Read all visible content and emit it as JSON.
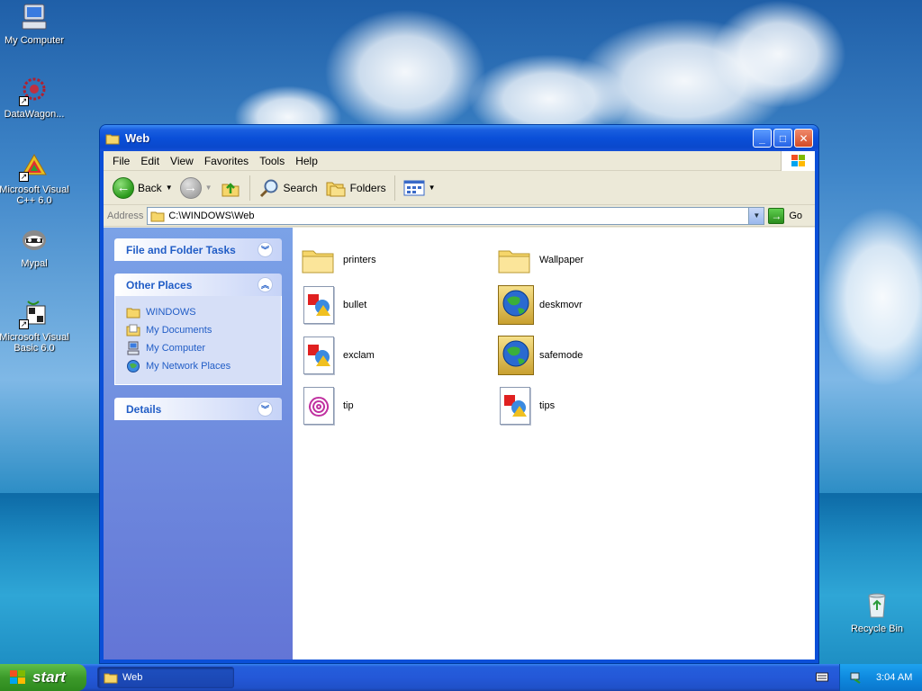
{
  "desktop": {
    "icons": [
      {
        "label": "My Computer"
      },
      {
        "label": "DataWagon..."
      },
      {
        "label": "Microsoft Visual C++ 6.0"
      },
      {
        "label": "Mypal"
      },
      {
        "label": "Microsoft Visual Basic 6.0"
      },
      {
        "label": "Recycle Bin"
      }
    ]
  },
  "window": {
    "title": "Web",
    "menu": [
      "File",
      "Edit",
      "View",
      "Favorites",
      "Tools",
      "Help"
    ],
    "toolbar": {
      "back": "Back",
      "search": "Search",
      "folders": "Folders"
    },
    "address": {
      "label": "Address",
      "value": "C:\\WINDOWS\\Web",
      "go": "Go"
    },
    "taskpane": {
      "file_folder_tasks": "File and Folder Tasks",
      "other_places": "Other Places",
      "places": [
        "WINDOWS",
        "My Documents",
        "My Computer",
        "My Network Places"
      ],
      "details": "Details"
    },
    "files": [
      {
        "name": "printers",
        "type": "folder"
      },
      {
        "name": "Wallpaper",
        "type": "folder"
      },
      {
        "name": "bullet",
        "type": "image"
      },
      {
        "name": "deskmovr",
        "type": "htm"
      },
      {
        "name": "exclam",
        "type": "image"
      },
      {
        "name": "safemode",
        "type": "htm"
      },
      {
        "name": "tip",
        "type": "gif"
      },
      {
        "name": "tips",
        "type": "image"
      }
    ]
  },
  "taskbar": {
    "start": "start",
    "task": "Web",
    "clock": "3:04 AM"
  }
}
